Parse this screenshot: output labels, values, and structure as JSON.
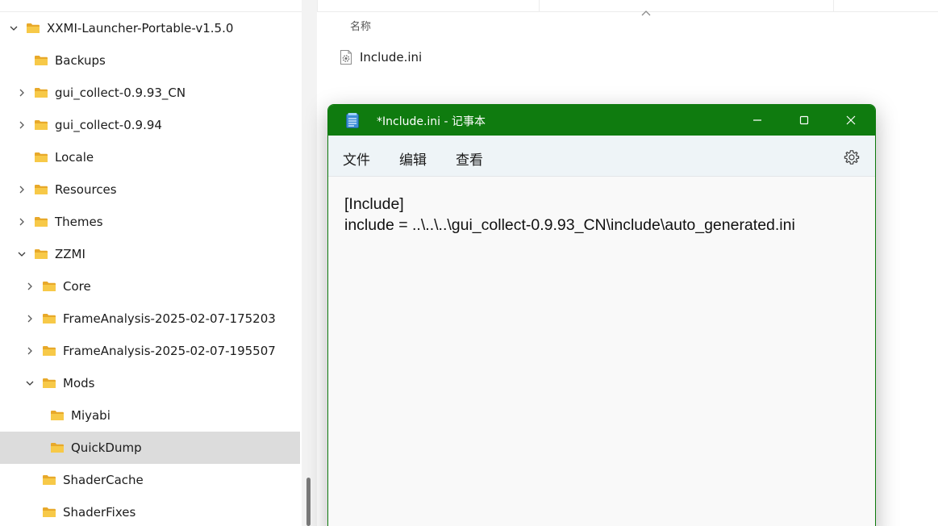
{
  "explorer": {
    "tree": [
      {
        "label": "XXMI-Launcher-Portable-v1.5.0",
        "expander": "expanded",
        "indent": 0,
        "selected": false
      },
      {
        "label": "Backups",
        "expander": "none",
        "indent": 1,
        "selected": false
      },
      {
        "label": "gui_collect-0.9.93_CN",
        "expander": "collapsed",
        "indent": 1,
        "selected": false
      },
      {
        "label": "gui_collect-0.9.94",
        "expander": "collapsed",
        "indent": 1,
        "selected": false
      },
      {
        "label": "Locale",
        "expander": "none",
        "indent": 1,
        "selected": false
      },
      {
        "label": "Resources",
        "expander": "collapsed",
        "indent": 1,
        "selected": false
      },
      {
        "label": "Themes",
        "expander": "collapsed",
        "indent": 1,
        "selected": false
      },
      {
        "label": "ZZMI",
        "expander": "expanded",
        "indent": 1,
        "selected": false
      },
      {
        "label": "Core",
        "expander": "collapsed",
        "indent": 2,
        "selected": false
      },
      {
        "label": "FrameAnalysis-2025-02-07-175203",
        "expander": "collapsed",
        "indent": 2,
        "selected": false
      },
      {
        "label": "FrameAnalysis-2025-02-07-195507",
        "expander": "collapsed",
        "indent": 2,
        "selected": false
      },
      {
        "label": "Mods",
        "expander": "expanded",
        "indent": 2,
        "selected": false
      },
      {
        "label": "Miyabi",
        "expander": "none",
        "indent": 3,
        "selected": false
      },
      {
        "label": "QuickDump",
        "expander": "none",
        "indent": 3,
        "selected": true
      },
      {
        "label": "ShaderCache",
        "expander": "none",
        "indent": 2,
        "selected": false
      },
      {
        "label": "ShaderFixes",
        "expander": "none",
        "indent": 2,
        "selected": false
      }
    ],
    "file_list": {
      "column_name": "名称",
      "files": [
        {
          "name": "Include.ini"
        }
      ]
    }
  },
  "notepad": {
    "title": "*Include.ini - 记事本",
    "menu": [
      "文件",
      "编辑",
      "查看"
    ],
    "content_lines": [
      "[Include]",
      "include = ..\\..\\..\\gui_collect-0.9.93_CN\\include\\auto_generated.ini"
    ],
    "colors": {
      "titlebar": "#0f7b0f",
      "menubar": "#eef4f7",
      "editor": "#f9f9f9"
    }
  },
  "colors": {
    "folder_body": "#f7c948",
    "folder_tab": "#e8a92a",
    "selected_row": "#dcdcdc"
  }
}
